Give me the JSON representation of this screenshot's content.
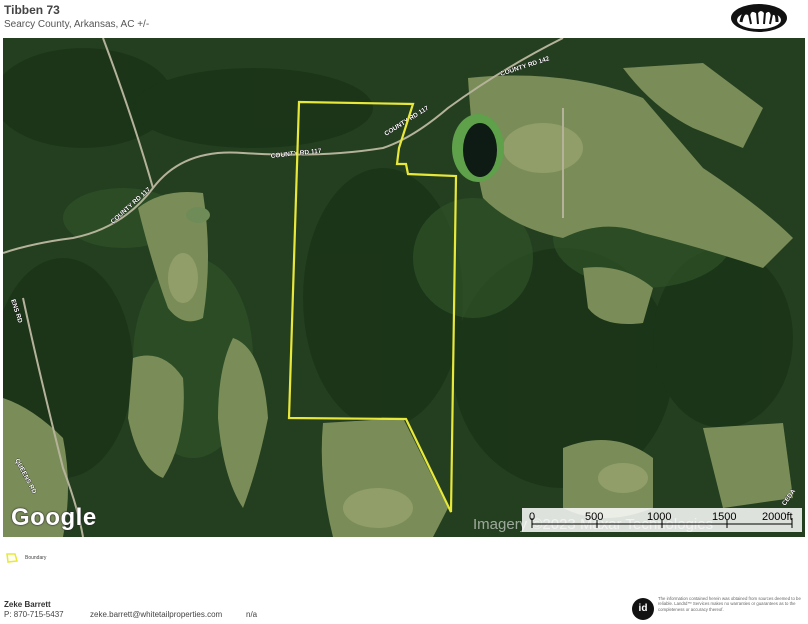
{
  "header": {
    "title": "Tibben 73",
    "subtitle": "Searcy County, Arkansas,  AC +/-"
  },
  "map": {
    "road_labels": [
      "COUNTY RD 142",
      "COUNTY RD 117",
      "COUNTY RD 117",
      "COUNTY RD 117",
      "ENS RD",
      "QUEENS RD",
      "CEDA"
    ],
    "attribution": "Imagery ©2023 Maxar Technologies",
    "google_logo": "Google",
    "scale": {
      "labels": [
        "0",
        "500",
        "1000",
        "1500",
        "2000ft"
      ]
    },
    "boundary_color": "#e8e83a"
  },
  "legend": {
    "label": "Boundary"
  },
  "footer": {
    "agent_name": "Zeke Barrett",
    "phone": "P: 870-715-5437",
    "email": "zeke.barrett@whitetailproperties.com",
    "na": "n/a",
    "badge": "id",
    "disclaimer": "The information contained herein was obtained from sources deemed to be reliable. LandId™ Services makes no warranties or guarantees as to the completeness or accuracy thereof."
  }
}
